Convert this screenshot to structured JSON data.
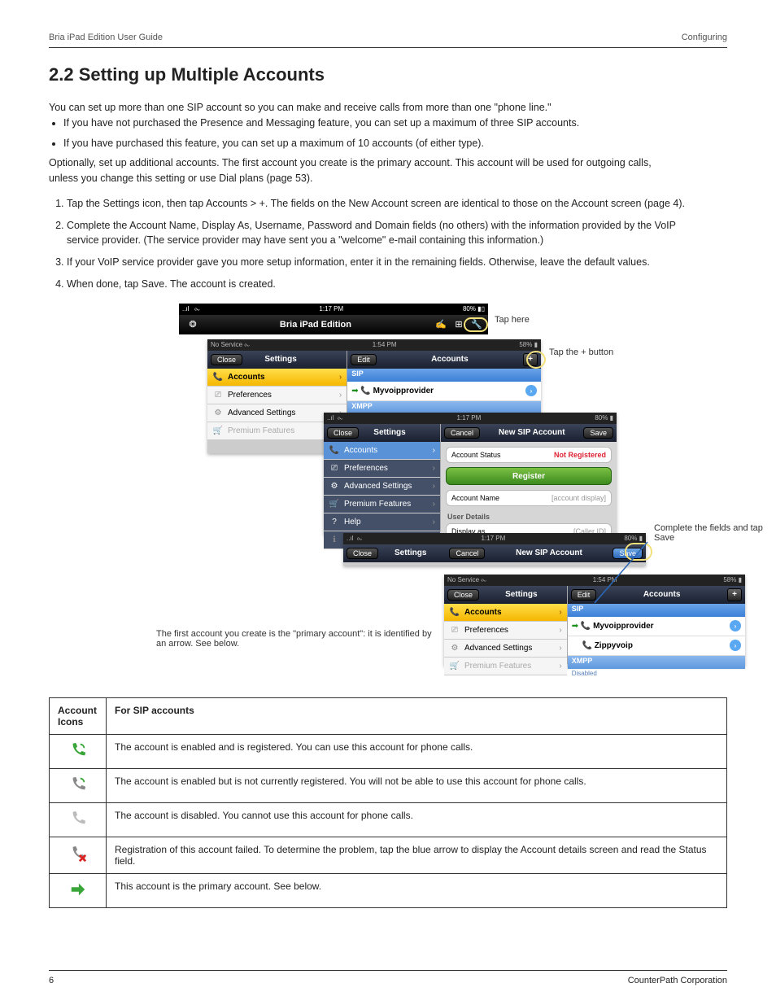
{
  "header": {
    "left": "Bria iPad Edition User Guide",
    "right": "Configuring"
  },
  "section": {
    "title": "2.2 Setting up Multiple Accounts"
  },
  "text": {
    "intro1": "You can set up more than one SIP account so you can make and receive calls from more than one \"phone line.\"",
    "bullet1": "If you have not purchased the Presence and Messaging feature, you can set up a maximum of three SIP accounts.",
    "bullet2": "If you have purchased this feature, you can set up a maximum of 10 accounts (of either type).",
    "intro2": "Optionally, set up additional accounts. The first account you create is the primary account. This account will be used for outgoing calls, unless you change this setting or use Dial plans (page 53).",
    "step1": "Tap the Settings icon, then tap Accounts > +. The fields on the New Account screen are identical to those on the Account screen (page 4).",
    "step2": "Complete the Account Name, Display As, Username, Password and Domain fields (no others) with the information provided by the VoIP service provider. (The service provider may have sent you a \"welcome\" e-mail containing this information.)",
    "step3": "If your VoIP service provider gave you more setup information, enter it in the remaining fields. Otherwise, leave the default values.",
    "step4": "When done, tap Save. The account is created."
  },
  "shots": {
    "bar": {
      "time": "1:17 PM",
      "batt": "80%",
      "title": "Bria iPad Edition"
    },
    "menu": {
      "accounts": "Accounts",
      "prefs": "Preferences",
      "adv": "Advanced Settings",
      "prem": "Premium Features",
      "help": "Help",
      "about": "About"
    },
    "p1": {
      "svc": "No Service ⧜",
      "time": "1:54 PM",
      "batt": "58% ▮",
      "close": "Close",
      "leftTitle": "Settings",
      "edit": "Edit",
      "rightTitle": "Accounts",
      "sip": "SIP",
      "xmpp": "XMPP",
      "acct1": "Myvoipprovider"
    },
    "p2": {
      "time": "1:17 PM",
      "batt": "80% ▮",
      "close": "Close",
      "leftTitle": "Settings",
      "cancel": "Cancel",
      "rightTitle": "New SIP Account",
      "save": "Save",
      "acctStatus": "Account Status",
      "notReg": "Not Registered",
      "register": "Register",
      "acctName": "Account Name",
      "acctNamePH": "[account display]",
      "userDetails": "User Details",
      "displayAs": "Display as",
      "displayAsPH": "[Caller ID]"
    },
    "p3": {
      "time": "1:17 PM",
      "batt": "80% ▮",
      "close": "Close",
      "leftTitle": "Settings",
      "cancel": "Cancel",
      "rightTitle": "New SIP Account",
      "save": "Save"
    },
    "p4": {
      "svc": "No Service ⧜",
      "time": "1:54 PM",
      "batt": "58% ▮",
      "close": "Close",
      "leftTitle": "Settings",
      "edit": "Edit",
      "rightTitle": "Accounts",
      "sip": "SIP",
      "xmpp": "XMPP",
      "disabled": "Disabled",
      "acct1": "Myvoipprovider",
      "acct2": "Zippyvoip"
    },
    "captions": {
      "c1": "Tap here",
      "c2": "Tap the + button",
      "c3": "Complete the fields and tap Save",
      "c4": "The first account you create is the \"primary account\": it is identified by an arrow. See below."
    }
  },
  "legend": {
    "h1": "Account Icons",
    "h2": "For SIP accounts",
    "r1": "The account is enabled and is registered. You can use this account for phone calls.",
    "r2": "The account is enabled but is not currently registered. You will not be able to use this account for phone calls.",
    "r3": "The account is disabled. You cannot use this account for phone calls.",
    "r4": "Registration of this account failed. To determine the problem, tap the blue arrow to display the Account details screen and read the Status field.",
    "r5": "This account is the primary account. See below."
  },
  "footer": {
    "page": "6",
    "right": "CounterPath Corporation"
  }
}
